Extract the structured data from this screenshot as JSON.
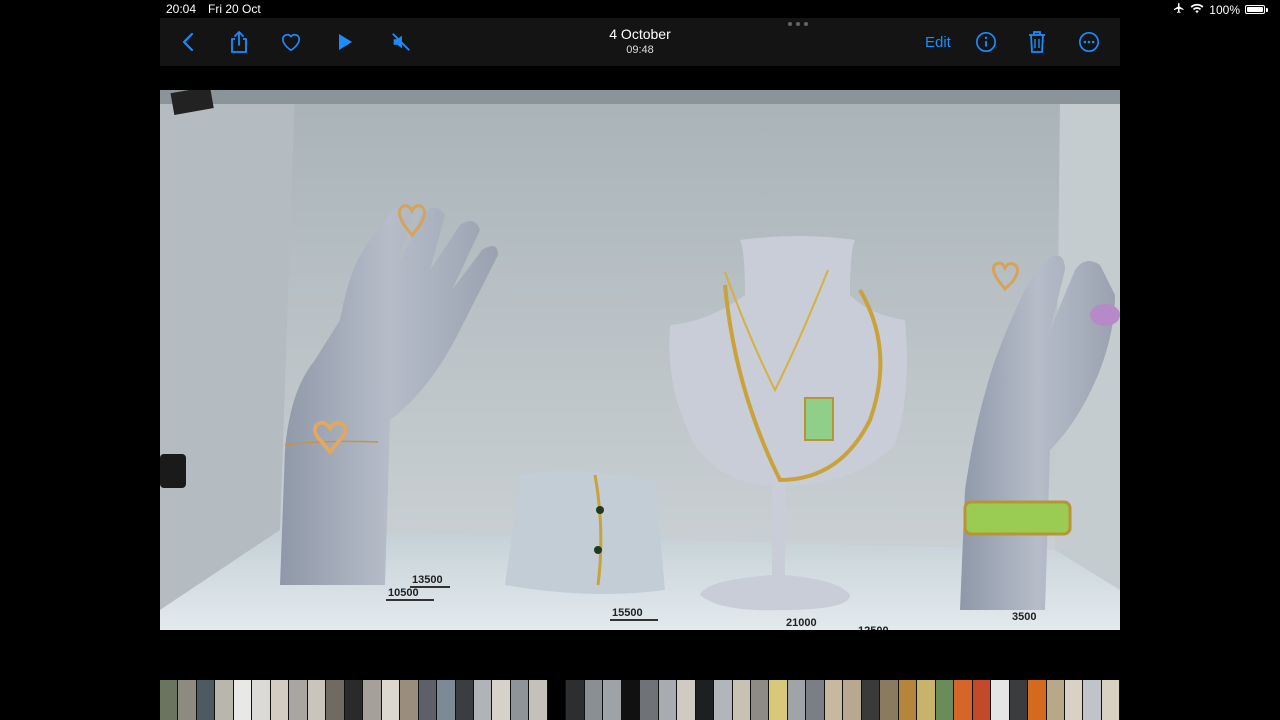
{
  "status_bar": {
    "time": "20:04",
    "date": "Fri 20 Oct",
    "battery": "100%"
  },
  "toolbar": {
    "title": "4 October",
    "subtitle": "09:48",
    "edit_label": "Edit",
    "accent_color": "#1a8cff"
  },
  "photo": {
    "price_tags": [
      "13500",
      "10500",
      "15500",
      "21000",
      "12500",
      "3500"
    ]
  },
  "filmstrip": {
    "thumb_colors": [
      "#6a7560",
      "#8d8a80",
      "#4d5a60",
      "#b9b6ad",
      "#e8e8e6",
      "#dcdad6",
      "#d2ccc2",
      "#a9a5a0",
      "#c9c4bc",
      "#6f6a62",
      "#2a2a2a",
      "#a6a09a",
      "#dcd8d0",
      "#9b8d7c",
      "#5d6068",
      "#7c8a96",
      "#3b3d40",
      "#b0b4b8",
      "#d6d2ca",
      "#8f9499",
      "#c5c1ba",
      "#000000",
      "#2c2e30",
      "#8a8f94",
      "#9ea3a8",
      "#111111",
      "#6f7378",
      "#a8acb0",
      "#cfcac2",
      "#1e1f20",
      "#b2b6ba",
      "#c7c2b4",
      "#8e8b86",
      "#d8c87a",
      "#a0a4a8",
      "#7a7f86",
      "#c8b8a0",
      "#b8a890",
      "#3a3a3a",
      "#8a7a60",
      "#b5853c",
      "#c7b36a",
      "#6a8c5a",
      "#d6652a",
      "#c24a2a",
      "#e5e5e5",
      "#3a3c3e",
      "#d46a1e",
      "#b8a88a",
      "#d9d2c4",
      "#c0c4c8",
      "#d8d0c0"
    ]
  }
}
